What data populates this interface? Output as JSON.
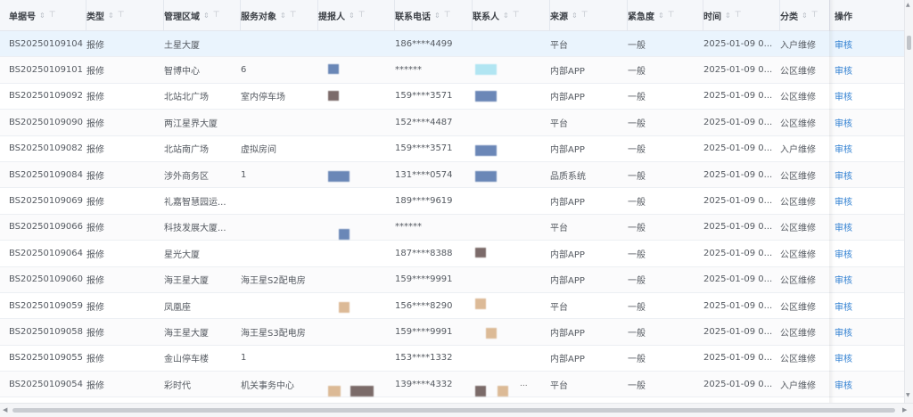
{
  "columns": [
    {
      "label": "单据号"
    },
    {
      "label": "类型"
    },
    {
      "label": "管理区域"
    },
    {
      "label": "服务对象"
    },
    {
      "label": "提报人"
    },
    {
      "label": "联系电话"
    },
    {
      "label": "联系人"
    },
    {
      "label": "来源"
    },
    {
      "label": "紧急度"
    },
    {
      "label": "时间"
    },
    {
      "label": "分类"
    },
    {
      "label": "操作"
    }
  ],
  "sort_glyph": "⇕",
  "filter_glyph": "⊤",
  "rows": [
    {
      "id": "BS20250109104",
      "type": "报修",
      "area": "土星大厦",
      "target": "",
      "phone": "186****4499",
      "source": "平台",
      "urgency": "一般",
      "time": "2025-01-09 0...",
      "category": "入户维修",
      "action": "审核"
    },
    {
      "id": "BS20250109101",
      "type": "报修",
      "area": "智博中心",
      "target": "6",
      "phone": "******",
      "source": "内部APP",
      "urgency": "一般",
      "time": "2025-01-09 0...",
      "category": "公区维修",
      "action": "审核"
    },
    {
      "id": "BS20250109092",
      "type": "报修",
      "area": "北站北广场",
      "target": "室内停车场",
      "phone": "159****3571",
      "source": "内部APP",
      "urgency": "一般",
      "time": "2025-01-09 0...",
      "category": "公区维修",
      "action": "审核"
    },
    {
      "id": "BS20250109090",
      "type": "报修",
      "area": "两江星界大厦",
      "target": "",
      "phone": "152****4487",
      "source": "平台",
      "urgency": "一般",
      "time": "2025-01-09 0...",
      "category": "公区维修",
      "action": "审核"
    },
    {
      "id": "BS20250109082",
      "type": "报修",
      "area": "北站南广场",
      "target": "虚拟房间",
      "phone": "159****3571",
      "source": "内部APP",
      "urgency": "一般",
      "time": "2025-01-09 0...",
      "category": "入户维修",
      "action": "审核"
    },
    {
      "id": "BS20250109084",
      "type": "报修",
      "area": "涉外商务区",
      "target": "1",
      "phone": "131****0574",
      "source": "品质系统",
      "urgency": "一般",
      "time": "2025-01-09 0...",
      "category": "公区维修",
      "action": "审核"
    },
    {
      "id": "BS20250109069",
      "type": "报修",
      "area": "礼嘉智慧园运...",
      "target": "",
      "phone": "189****9619",
      "source": "内部APP",
      "urgency": "一般",
      "time": "2025-01-09 0...",
      "category": "公区维修",
      "action": "审核"
    },
    {
      "id": "BS20250109066",
      "type": "报修",
      "area": "科技发展大厦...",
      "target": "",
      "phone": "******",
      "source": "平台",
      "urgency": "一般",
      "time": "2025-01-09 0...",
      "category": "公区维修",
      "action": "审核"
    },
    {
      "id": "BS20250109064",
      "type": "报修",
      "area": "星光大厦",
      "target": "",
      "phone": "187****8388",
      "source": "内部APP",
      "urgency": "一般",
      "time": "2025-01-09 0...",
      "category": "公区维修",
      "action": "审核"
    },
    {
      "id": "BS20250109060",
      "type": "报修",
      "area": "海王星大厦",
      "target": "海王星S2配电房",
      "phone": "159****9991",
      "source": "内部APP",
      "urgency": "一般",
      "time": "2025-01-09 0...",
      "category": "公区维修",
      "action": "审核"
    },
    {
      "id": "BS20250109059",
      "type": "报修",
      "area": "凤凰座",
      "target": "",
      "phone": "156****8290",
      "source": "平台",
      "urgency": "一般",
      "time": "2025-01-09 0...",
      "category": "公区维修",
      "action": "审核"
    },
    {
      "id": "BS20250109058",
      "type": "报修",
      "area": "海王星大厦",
      "target": "海王星S3配电房",
      "phone": "159****9991",
      "source": "内部APP",
      "urgency": "一般",
      "time": "2025-01-09 0...",
      "category": "公区维修",
      "action": "审核"
    },
    {
      "id": "BS20250109055",
      "type": "报修",
      "area": "金山停车楼",
      "target": "1",
      "phone": "153****1332",
      "source": "内部APP",
      "urgency": "一般",
      "time": "2025-01-09 0...",
      "category": "公区维修",
      "action": "审核"
    },
    {
      "id": "BS20250109054",
      "type": "报修",
      "area": "彩时代",
      "target": "机关事务中心",
      "phone": "139****4332",
      "source": "平台",
      "urgency": "一般",
      "time": "2025-01-09 0...",
      "category": "入户维修",
      "action": "审核"
    }
  ],
  "partial_text": "...",
  "colors": {
    "link": "#2f7fd1",
    "header_bg": "#f5f7fa",
    "highlight_row": "#eaf4fd",
    "redaction_blue": "#5b7bb0",
    "redaction_cyan": "#a9e3f2",
    "redaction_brown": "#6e5c5a",
    "redaction_tan": "#d9b38c"
  }
}
